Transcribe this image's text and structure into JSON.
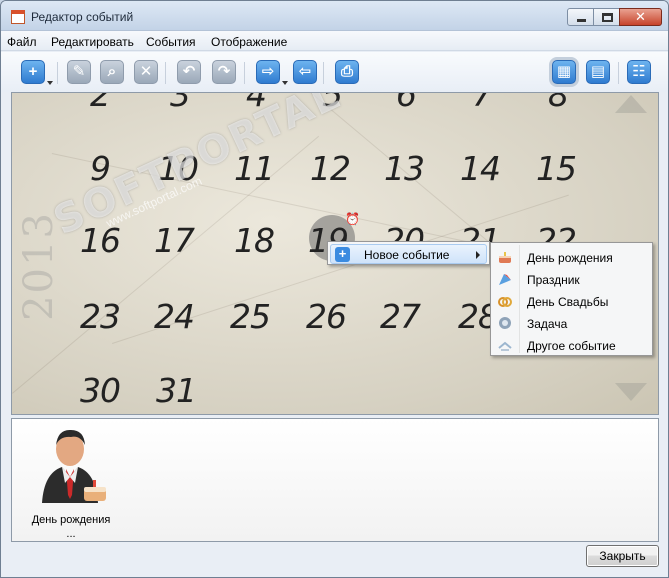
{
  "window": {
    "title": "Редактор событий"
  },
  "menubar": {
    "items": [
      "Файл",
      "Редактировать",
      "События",
      "Отображение"
    ]
  },
  "calendar": {
    "year": "2013",
    "rows": [
      [
        "2",
        "3",
        "4",
        "5",
        "6",
        "7",
        "8"
      ],
      [
        "9",
        "10",
        "11",
        "12",
        "13",
        "14",
        "15"
      ],
      [
        "16",
        "17",
        "18",
        "19",
        "20",
        "21",
        "22"
      ],
      [
        "23",
        "24",
        "25",
        "26",
        "27",
        "28"
      ],
      [
        "30",
        "31"
      ]
    ]
  },
  "watermark": {
    "text": "SOFTPORTAL",
    "sub": "www.softportal.com"
  },
  "context_menu": {
    "item": "Новое событие",
    "submenu": [
      "День рождения",
      "Праздник",
      "День Свадьбы",
      "Задача",
      "Другое событие"
    ]
  },
  "events": [
    {
      "label": "День рождения ..."
    }
  ],
  "footer": {
    "close_label": "Закрыть"
  },
  "colors": {
    "accent": "#2f7bd0",
    "calendar_bg": "#e3dfd2",
    "menu_highlight": "#cfe3fa"
  }
}
